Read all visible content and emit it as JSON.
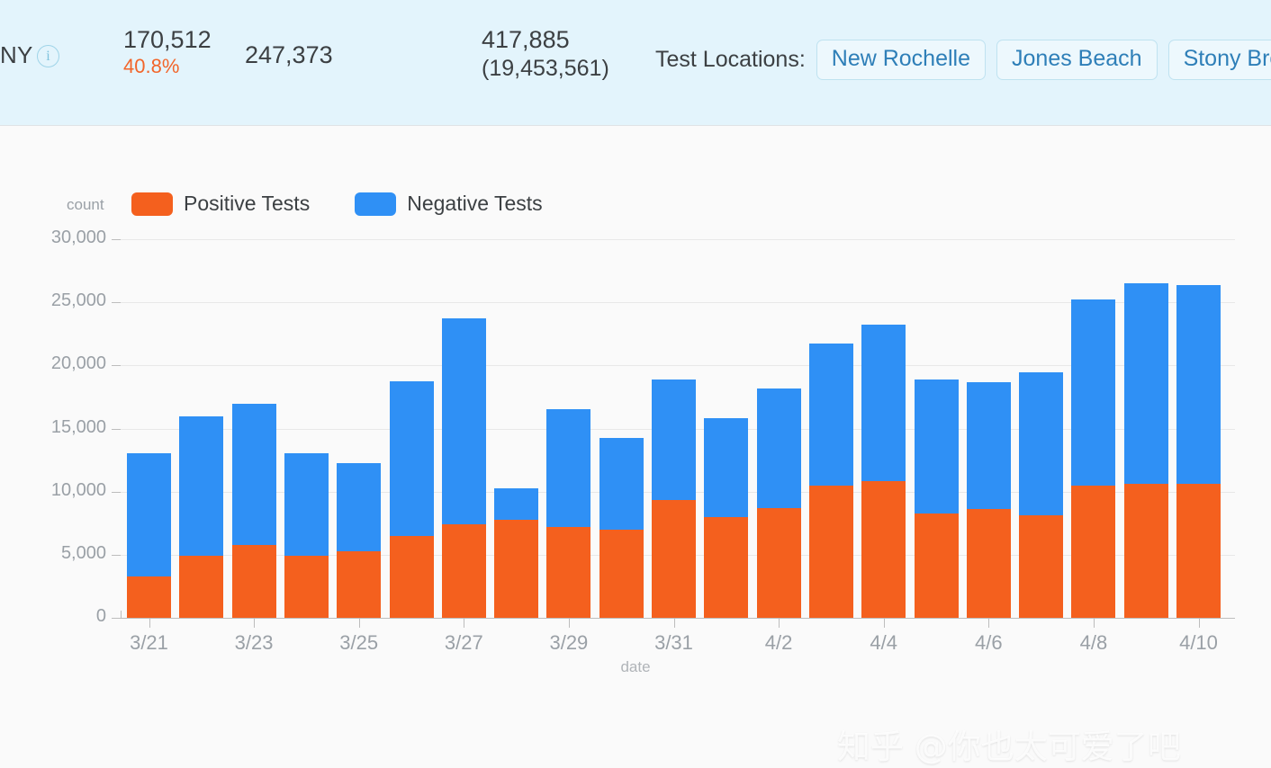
{
  "header": {
    "state": "NY",
    "info_icon": "info-circle-icon",
    "stat_positive": "170,512",
    "stat_positive_pct": "40.8%",
    "stat_negative": "247,373",
    "stat_total": "417,885",
    "stat_population": "(19,453,561)",
    "locations_label": "Test Locations:",
    "locations": [
      "New Rochelle",
      "Jones Beach",
      "Stony Brook"
    ]
  },
  "chart_data": {
    "type": "bar",
    "subtype": "stacked",
    "title": "",
    "count_label": "count",
    "xlabel": "date",
    "ylabel": "count",
    "ylim": [
      0,
      30000
    ],
    "yticks": [
      0,
      5000,
      10000,
      15000,
      20000,
      25000,
      30000
    ],
    "ytick_labels": [
      "0",
      "5,000",
      "10,000",
      "15,000",
      "20,000",
      "25,000",
      "30,000"
    ],
    "grid": true,
    "legend_position": "top-left",
    "colors": {
      "positive": "#F4601E",
      "negative": "#2F90F5"
    },
    "categories": [
      "3/21",
      "3/22",
      "3/23",
      "3/24",
      "3/25",
      "3/26",
      "3/27",
      "3/28",
      "3/29",
      "3/30",
      "3/31",
      "4/1",
      "4/2",
      "4/3",
      "4/4",
      "4/5",
      "4/6",
      "4/7",
      "4/8",
      "4/9",
      "4/10"
    ],
    "xtick_labels": [
      "3/21",
      "3/23",
      "3/25",
      "3/27",
      "3/29",
      "3/31",
      "4/2",
      "4/4",
      "4/6",
      "4/8",
      "4/10"
    ],
    "series": [
      {
        "name": "Positive Tests",
        "color": "#F4601E",
        "values": [
          3250,
          4900,
          5800,
          4900,
          5250,
          6500,
          7400,
          7750,
          7200,
          7000,
          9350,
          8000,
          8700,
          10500,
          10850,
          8250,
          8650,
          8150,
          10500,
          10650,
          10600
        ]
      },
      {
        "name": "Negative Tests",
        "color": "#2F90F5",
        "values": [
          9800,
          11050,
          11150,
          8150,
          7000,
          12250,
          16350,
          2500,
          9300,
          7250,
          9500,
          7800,
          9500,
          11200,
          12400,
          10600,
          10050,
          11300,
          14750,
          15850,
          15800
        ]
      }
    ],
    "totals": [
      13050,
      15950,
      16950,
      13050,
      12250,
      18750,
      23750,
      10250,
      16500,
      14250,
      18850,
      15800,
      18200,
      21700,
      23250,
      18850,
      18700,
      19450,
      25250,
      26500,
      26400
    ]
  },
  "watermark": "知乎 @你也太可爱了吧"
}
